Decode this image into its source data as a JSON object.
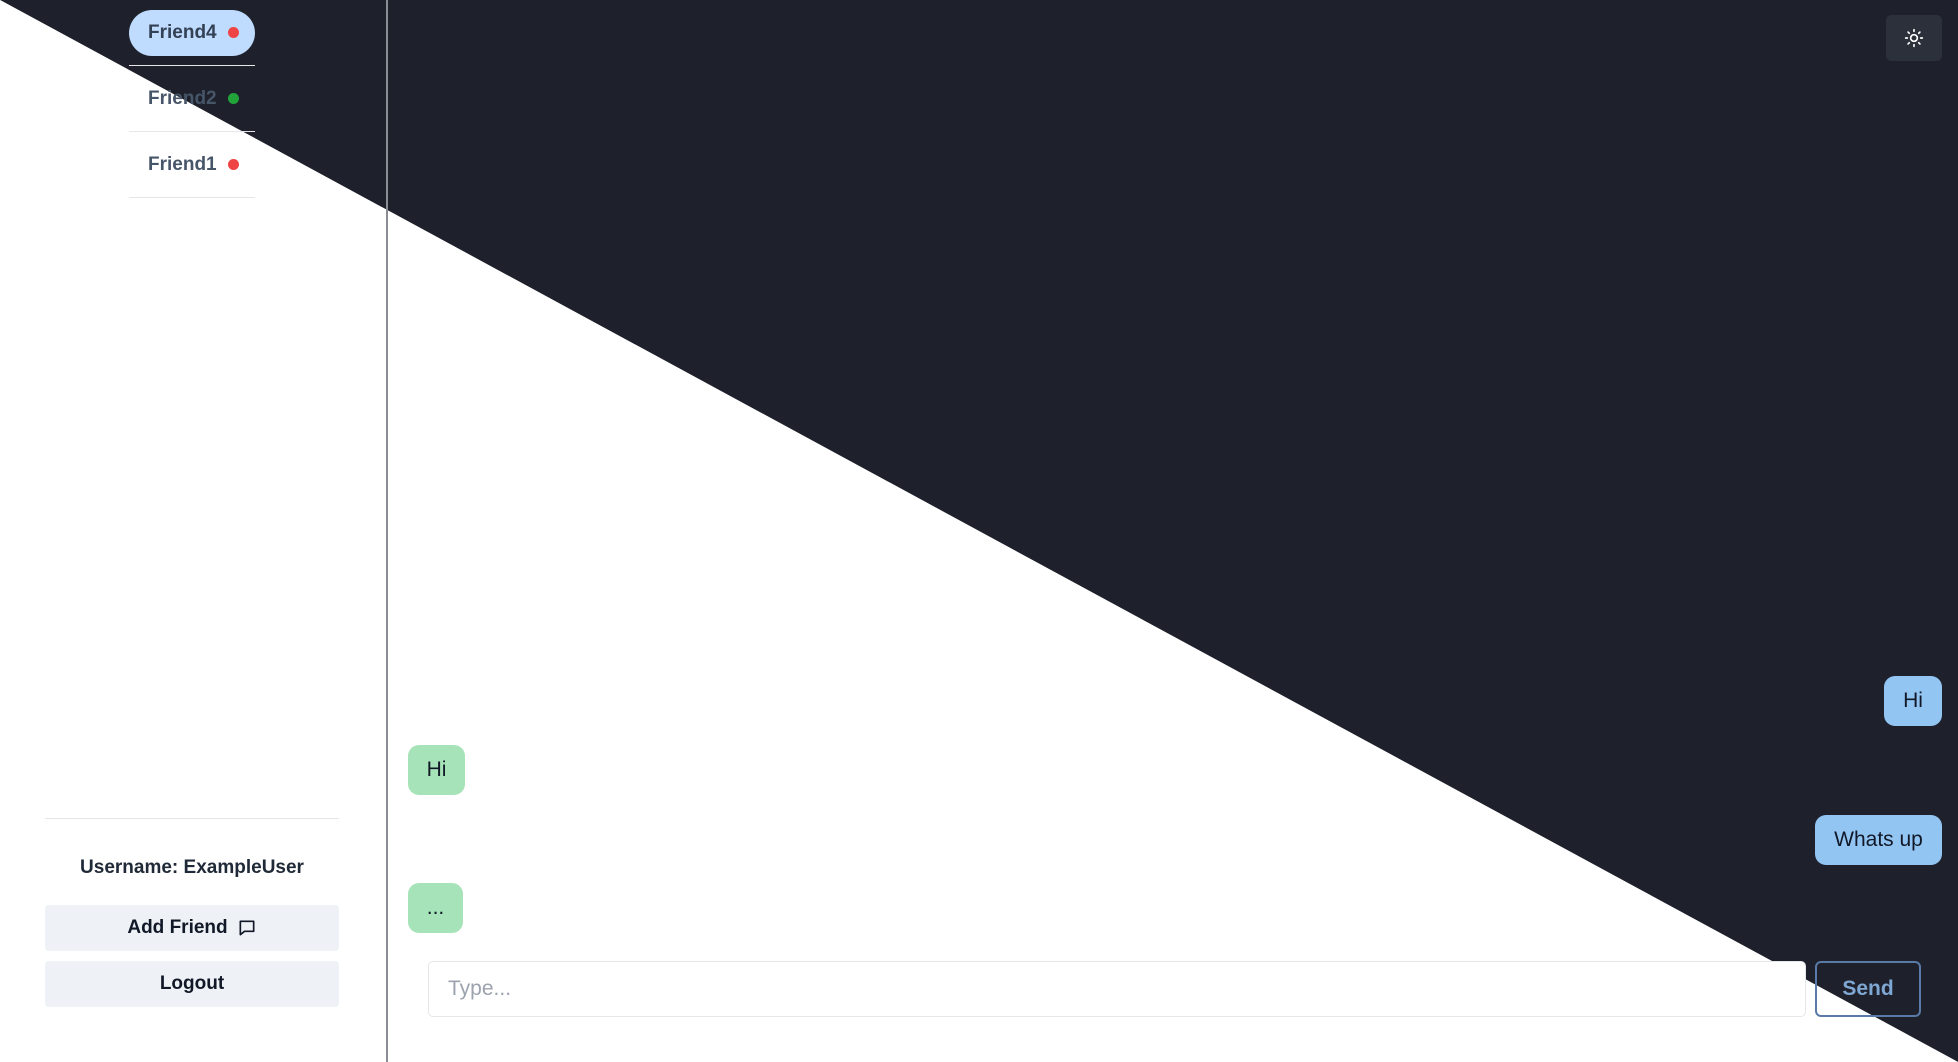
{
  "theme": {
    "dark_bg": "#1e212b",
    "light_bg": "#ffffff",
    "accent_active": "#bfdbfe",
    "sent_bubble": "#93c5f3",
    "received_bubble": "#a7e3b8"
  },
  "sidebar": {
    "friends": [
      {
        "name": "Friend4",
        "status_color": "#ef4444",
        "active": true
      },
      {
        "name": "Friend2",
        "status_color": "#22a33a",
        "active": false
      },
      {
        "name": "Friend1",
        "status_color": "#ef4444",
        "active": false
      }
    ],
    "username_label": "Username: ExampleUser",
    "add_friend_label": "Add Friend",
    "add_friend_icon": "message-square-icon",
    "logout_label": "Logout"
  },
  "header": {
    "theme_toggle_icon": "sun-icon"
  },
  "chat": {
    "messages": [
      {
        "text": "Hi",
        "direction": "sent"
      },
      {
        "text": "Hi",
        "direction": "received"
      },
      {
        "text": "Whats up",
        "direction": "sent"
      },
      {
        "text": "...",
        "direction": "received"
      }
    ],
    "input_placeholder": "Type...",
    "input_value": "",
    "send_label": "Send"
  }
}
